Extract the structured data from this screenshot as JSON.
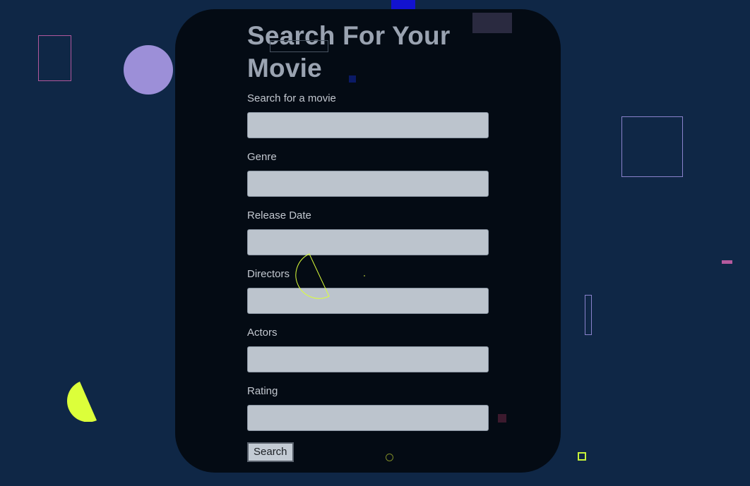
{
  "page": {
    "title_line1": "Search For Your",
    "title_line2": "Movie"
  },
  "form": {
    "fields": [
      {
        "label": "Search for a movie",
        "value": "",
        "placeholder": ""
      },
      {
        "label": "Genre",
        "value": "",
        "placeholder": ""
      },
      {
        "label": "Release Date",
        "value": "",
        "placeholder": ""
      },
      {
        "label": "Directors",
        "value": "",
        "placeholder": ""
      },
      {
        "label": "Actors",
        "value": "",
        "placeholder": ""
      },
      {
        "label": "Rating",
        "value": "",
        "placeholder": ""
      }
    ],
    "submit_label": "Search"
  },
  "colors": {
    "background": "#0f2746",
    "card": "#040b14",
    "title": "#9aa3b1",
    "input_fill": "#bcc4cd",
    "accent_lavender": "#9c8fd8",
    "accent_yellow": "#dcff3a",
    "accent_pink": "#b55a9e"
  }
}
